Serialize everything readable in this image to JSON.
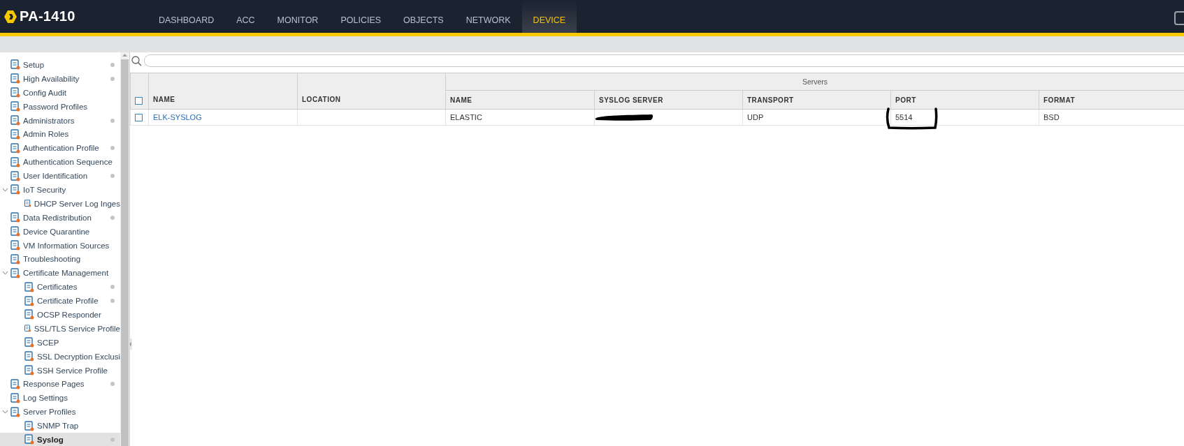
{
  "header": {
    "logo": "PA-1410"
  },
  "nav_tabs": [
    {
      "label": "DASHBOARD",
      "selected": false
    },
    {
      "label": "ACC",
      "selected": false
    },
    {
      "label": "MONITOR",
      "selected": false
    },
    {
      "label": "POLICIES",
      "selected": false
    },
    {
      "label": "OBJECTS",
      "selected": false
    },
    {
      "label": "NETWORK",
      "selected": false
    },
    {
      "label": "DEVICE",
      "selected": true
    }
  ],
  "sidebar": {
    "items": [
      {
        "label": "Setup",
        "selected": false,
        "modified": true
      },
      {
        "label": "High Availability",
        "selected": false,
        "modified": true
      },
      {
        "label": "Config Audit",
        "selected": false,
        "modified": false
      },
      {
        "label": "Password Profiles",
        "selected": false,
        "modified": false
      },
      {
        "label": "Administrators",
        "selected": false,
        "modified": true
      },
      {
        "label": "Admin Roles",
        "selected": false,
        "modified": false
      },
      {
        "label": "Authentication Profile",
        "selected": false,
        "modified": true
      },
      {
        "label": "Authentication Sequence",
        "selected": false,
        "modified": false
      },
      {
        "label": "User Identification",
        "selected": false,
        "modified": true
      },
      {
        "label": "IoT Security",
        "selected": false,
        "modified": false,
        "expanded": true,
        "children": [
          {
            "label": "DHCP Server Log Inges",
            "selected": false,
            "modified": false
          }
        ]
      },
      {
        "label": "Data Redistribution",
        "selected": false,
        "modified": true
      },
      {
        "label": "Device Quarantine",
        "selected": false,
        "modified": false
      },
      {
        "label": "VM Information Sources",
        "selected": false,
        "modified": false
      },
      {
        "label": "Troubleshooting",
        "selected": false,
        "modified": false
      },
      {
        "label": "Certificate Management",
        "selected": false,
        "modified": false,
        "expanded": true,
        "children": [
          {
            "label": "Certificates",
            "selected": false,
            "modified": true
          },
          {
            "label": "Certificate Profile",
            "selected": false,
            "modified": true
          },
          {
            "label": "OCSP Responder",
            "selected": false,
            "modified": false
          },
          {
            "label": "SSL/TLS Service Profile",
            "selected": false,
            "modified": false
          },
          {
            "label": "SCEP",
            "selected": false,
            "modified": false
          },
          {
            "label": "SSL Decryption Exclusi",
            "selected": false,
            "modified": false
          },
          {
            "label": "SSH Service Profile",
            "selected": false,
            "modified": false
          }
        ]
      },
      {
        "label": "Response Pages",
        "selected": false,
        "modified": true
      },
      {
        "label": "Log Settings",
        "selected": false,
        "modified": false
      },
      {
        "label": "Server Profiles",
        "selected": false,
        "modified": false,
        "expanded": true,
        "children": [
          {
            "label": "SNMP Trap",
            "selected": false,
            "modified": false
          },
          {
            "label": "Syslog",
            "selected": true,
            "modified": true
          }
        ]
      }
    ]
  },
  "table": {
    "all_checked": false,
    "group_heading": "Servers",
    "columns": [
      "NAME",
      "LOCATION",
      "NAME",
      "SYSLOG SERVER",
      "TRANSPORT",
      "PORT",
      "FORMAT"
    ],
    "rows": [
      {
        "checked": false,
        "name": "ELK-SYSLOG",
        "server_name": "ELASTIC",
        "syslog_server_redacted": true,
        "transport": "UDP",
        "port": "5514",
        "port_marked": true,
        "format": "BSD"
      }
    ]
  }
}
